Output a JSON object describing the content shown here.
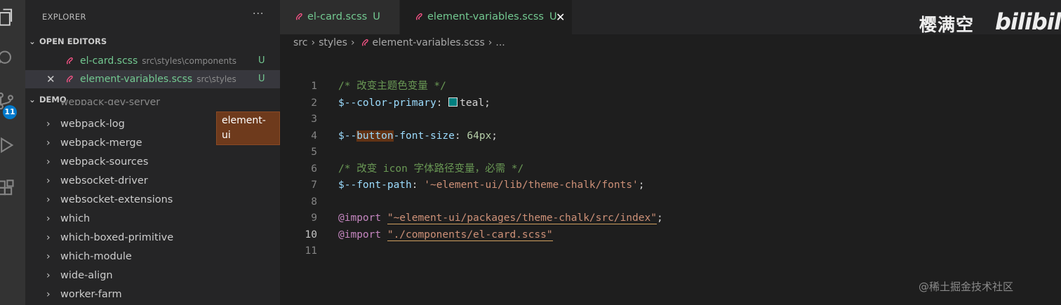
{
  "sidebar": {
    "title": "EXPLORER",
    "more": "···",
    "open_editors_label": "OPEN EDITORS",
    "open_editors": [
      {
        "name": "el-card.scss",
        "path": "src\\styles\\components",
        "status": "U"
      },
      {
        "name": "element-variables.scss",
        "path": "src\\styles",
        "status": "U"
      }
    ],
    "project_label": "DEMO",
    "clipped_item": "webpack-dev-server",
    "tree": [
      {
        "label": "webpack-log"
      },
      {
        "label": "webpack-merge"
      },
      {
        "label": "webpack-sources"
      },
      {
        "label": "websocket-driver"
      },
      {
        "label": "websocket-extensions"
      },
      {
        "label": "which"
      },
      {
        "label": "which-boxed-primitive"
      },
      {
        "label": "which-module"
      },
      {
        "label": "wide-align"
      },
      {
        "label": "worker-farm"
      }
    ],
    "tooltip": "element-ui"
  },
  "activity": {
    "badge": "11"
  },
  "tabs": [
    {
      "name": "el-card.scss",
      "status": "U"
    },
    {
      "name": "element-variables.scss",
      "status": "U",
      "close": "✕"
    }
  ],
  "breadcrumb": {
    "seg1": "src",
    "seg2": "styles",
    "seg3": "element-variables.scss",
    "tail": "..."
  },
  "editor": {
    "line_numbers": [
      "1",
      "2",
      "3",
      "4",
      "5",
      "6",
      "7",
      "8",
      "9",
      "10",
      "11"
    ],
    "l1": "/* 改变主题色变量 */",
    "l2_var": "$--color-primary",
    "l2_colon": ": ",
    "l2_val": "teal",
    "l2_end": ";",
    "l4_a": "$--",
    "l4_b": "button",
    "l4_c": "-font-size",
    "l4_colon": ": ",
    "l4_val": "64px",
    "l4_end": ";",
    "l6": "/* 改变 icon 字体路径变量，必需 */",
    "l7_var": "$--font-path",
    "l7_colon": ": ",
    "l7_val": "'~element-ui/lib/theme-chalk/fonts'",
    "l7_end": ";",
    "l9_kw": "@import",
    "l9_val": "\"~element-ui/packages/theme-chalk/src/index\"",
    "l9_end": ";",
    "l10_kw": "@import",
    "l10_val": "\"./components/el-card.scss\""
  },
  "watermark": {
    "text": "樱满空",
    "logo": "bilibili",
    "footer": "@稀土掘金技术社区"
  },
  "colors": {
    "accent": "#007acc",
    "untracked": "#73c991",
    "swatch_teal": "#008080"
  }
}
